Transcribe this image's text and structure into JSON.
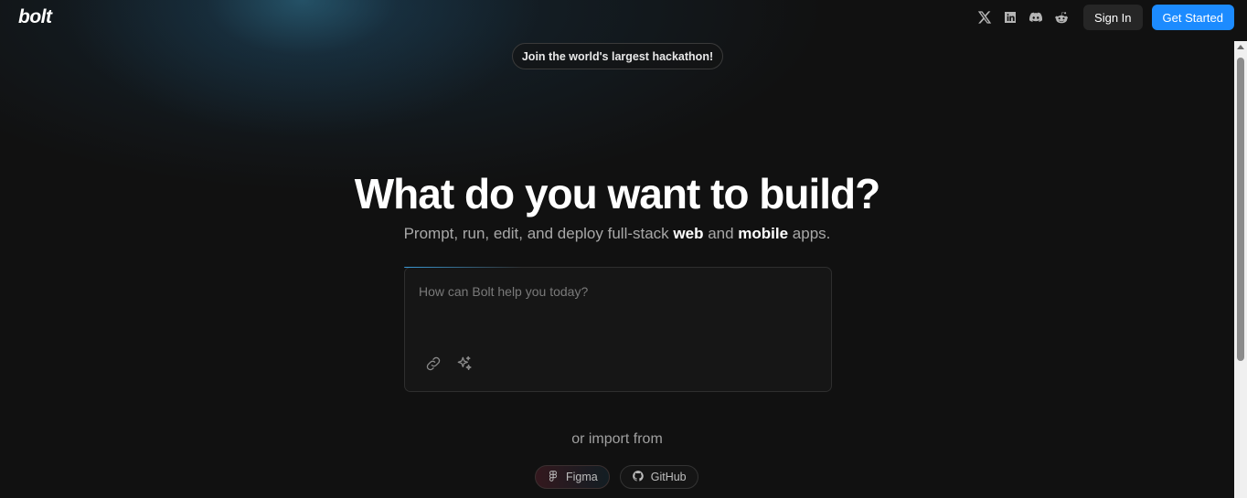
{
  "header": {
    "logo": "bolt",
    "social": [
      {
        "name": "x-icon"
      },
      {
        "name": "linkedin-icon"
      },
      {
        "name": "discord-icon"
      },
      {
        "name": "reddit-icon"
      }
    ],
    "sign_in_label": "Sign In",
    "get_started_label": "Get Started"
  },
  "banner": {
    "pill_label": "Join the world's largest hackathon!"
  },
  "hero": {
    "title": "What do you want to build?",
    "subtitle_part1": "Prompt, run, edit, and deploy full-stack ",
    "subtitle_bold1": "web",
    "subtitle_part2": " and ",
    "subtitle_bold2": "mobile",
    "subtitle_part3": " apps."
  },
  "prompt": {
    "placeholder": "How can Bolt help you today?",
    "value": ""
  },
  "import": {
    "label": "or import from",
    "figma_label": "Figma",
    "github_label": "GitHub"
  },
  "colors": {
    "background": "#111111",
    "accent": "#1c8bff",
    "secondary_button": "#262626"
  }
}
